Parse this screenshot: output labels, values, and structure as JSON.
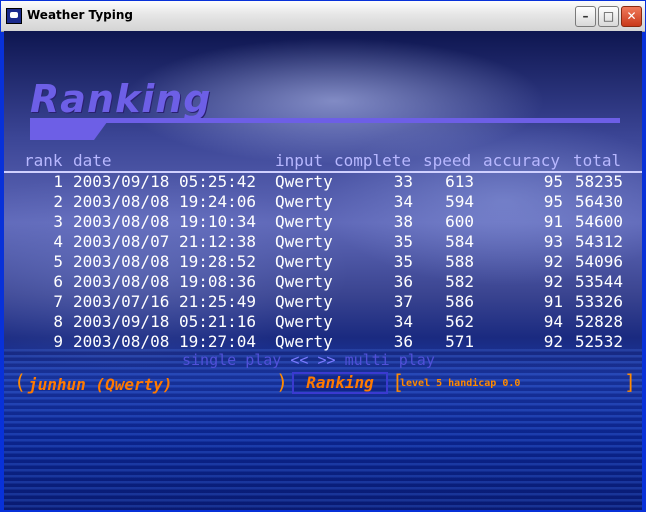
{
  "window": {
    "title": "Weather Typing"
  },
  "screen": {
    "heading": "Ranking",
    "columns": [
      "rank",
      "date",
      "input",
      "complete",
      "speed",
      "accuracy",
      "total"
    ],
    "rows": [
      {
        "rank": "1",
        "date": "2003/09/18 05:25:42",
        "input": "Qwerty",
        "complete": "33",
        "speed": "613",
        "accuracy": "95",
        "total": "58235"
      },
      {
        "rank": "2",
        "date": "2003/08/08 19:24:06",
        "input": "Qwerty",
        "complete": "34",
        "speed": "594",
        "accuracy": "95",
        "total": "56430"
      },
      {
        "rank": "3",
        "date": "2003/08/08 19:10:34",
        "input": "Qwerty",
        "complete": "38",
        "speed": "600",
        "accuracy": "91",
        "total": "54600"
      },
      {
        "rank": "4",
        "date": "2003/08/07 21:12:38",
        "input": "Qwerty",
        "complete": "35",
        "speed": "584",
        "accuracy": "93",
        "total": "54312"
      },
      {
        "rank": "5",
        "date": "2003/08/08 19:28:52",
        "input": "Qwerty",
        "complete": "35",
        "speed": "588",
        "accuracy": "92",
        "total": "54096"
      },
      {
        "rank": "6",
        "date": "2003/08/08 19:08:36",
        "input": "Qwerty",
        "complete": "36",
        "speed": "582",
        "accuracy": "92",
        "total": "53544"
      },
      {
        "rank": "7",
        "date": "2003/07/16 21:25:49",
        "input": "Qwerty",
        "complete": "37",
        "speed": "586",
        "accuracy": "91",
        "total": "53326"
      },
      {
        "rank": "8",
        "date": "2003/09/18 05:21:16",
        "input": "Qwerty",
        "complete": "34",
        "speed": "562",
        "accuracy": "94",
        "total": "52828"
      },
      {
        "rank": "9",
        "date": "2003/08/08 19:27:04",
        "input": "Qwerty",
        "complete": "36",
        "speed": "571",
        "accuracy": "92",
        "total": "52532"
      }
    ],
    "mode_left": "single play",
    "mode_arrows": "<< >>",
    "mode_right": "multi play"
  },
  "status": {
    "player": "junhun (Qwerty)",
    "ranking_button": "Ranking",
    "level": "level  5 handicap 0.0"
  },
  "colors": {
    "accent": "#6d5fe6",
    "highlight": "#ff7a00",
    "text": "#ffffff",
    "header": "#b8b8ff"
  }
}
